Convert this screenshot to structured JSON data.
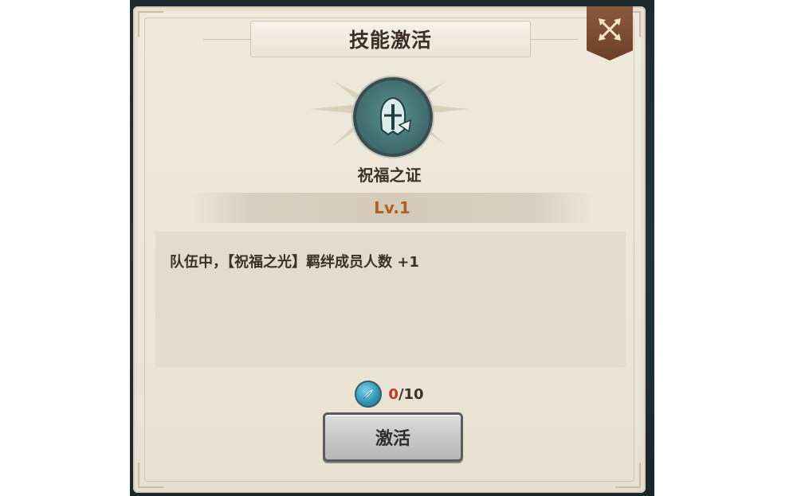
{
  "dialog": {
    "title": "技能激活",
    "close_icon": "crossed-arrows-icon"
  },
  "skill": {
    "icon": "knight-helmet-icon",
    "name": "祝福之证",
    "level": "Lv.1",
    "description": "队伍中，【祝福之光】羁绊成员人数 +1"
  },
  "cost": {
    "icon": "feather-token-icon",
    "current": "0",
    "separator": "/",
    "required": "10",
    "current_color": "#c0392b"
  },
  "actions": {
    "activate_label": "激活"
  },
  "colors": {
    "panel_bg": "#ede6d6",
    "level_color": "#b06024",
    "close_button": "#7a4a32"
  }
}
